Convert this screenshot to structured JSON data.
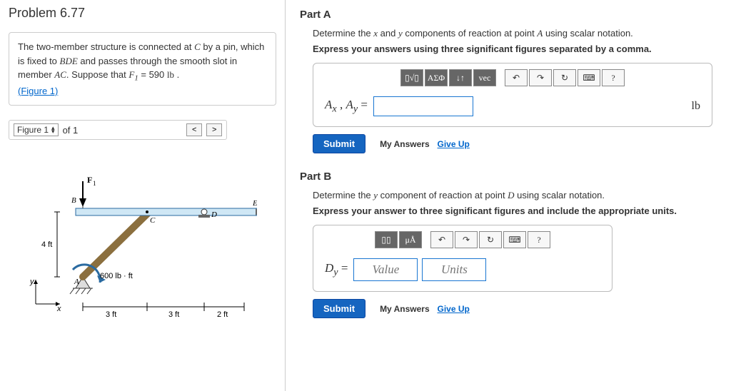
{
  "problem": {
    "title": "Problem 6.77",
    "desc_pre": "The two-member structure is connected at ",
    "desc_C": "C",
    "desc_mid1": " by a pin, which is fixed to ",
    "desc_BDE": "BDE",
    "desc_mid2": " and passes through the smooth slot in member ",
    "desc_AC": "AC",
    "desc_mid3": ". Suppose that ",
    "desc_F1": "F",
    "desc_F1sub": "1",
    "desc_eq": " = 590 ",
    "desc_unit": "lb",
    "desc_end": " .",
    "figure_link": "(Figure 1)"
  },
  "figureNav": {
    "label": "Figure 1",
    "of": "of 1"
  },
  "figure": {
    "F1": "F",
    "F1sub": "1",
    "B": "B",
    "E": "E",
    "C": "C",
    "D": "D",
    "A": "A",
    "ft4": "4 ft",
    "moment": "600 lb · ft",
    "ft3a": "3 ft",
    "ft3b": "3 ft",
    "ft2": "2 ft",
    "x": "x",
    "y": "y"
  },
  "partA": {
    "title": "Part A",
    "prompt_pre": "Determine the ",
    "prompt_x": "x",
    "prompt_and": " and ",
    "prompt_y": "y",
    "prompt_mid": " components of reaction at point ",
    "prompt_A": "A",
    "prompt_end": " using scalar notation.",
    "bold": "Express your answers using three significant figures separated by a comma.",
    "toolbar": {
      "t1": "▯√▯",
      "t2": "ΑΣΦ",
      "t3": "↓↑",
      "t4": "vec",
      "undo": "↶",
      "redo": "↷",
      "reset": "↻",
      "kb": "⌨",
      "help": "?"
    },
    "lhs_Ax": "A",
    "lhs_xs": "x",
    "lhs_sep": " , ",
    "lhs_Ay": "A",
    "lhs_ys": "y",
    "lhs_eq": " =",
    "unit": "lb",
    "submit": "Submit",
    "myAnswers": "My Answers",
    "giveUp": "Give Up"
  },
  "partB": {
    "title": "Part B",
    "prompt_pre": "Determine the ",
    "prompt_y": "y",
    "prompt_mid": " component of reaction at point ",
    "prompt_D": "D",
    "prompt_end": " using scalar notation.",
    "bold": "Express your answer to three significant figures and include the appropriate units.",
    "toolbar": {
      "t1": "▯▯",
      "t2": "μÅ",
      "undo": "↶",
      "redo": "↷",
      "reset": "↻",
      "kb": "⌨",
      "help": "?"
    },
    "lhs_D": "D",
    "lhs_ys": "y",
    "lhs_eq": " =",
    "valuePH": "Value",
    "unitsPH": "Units",
    "submit": "Submit",
    "myAnswers": "My Answers",
    "giveUp": "Give Up"
  }
}
